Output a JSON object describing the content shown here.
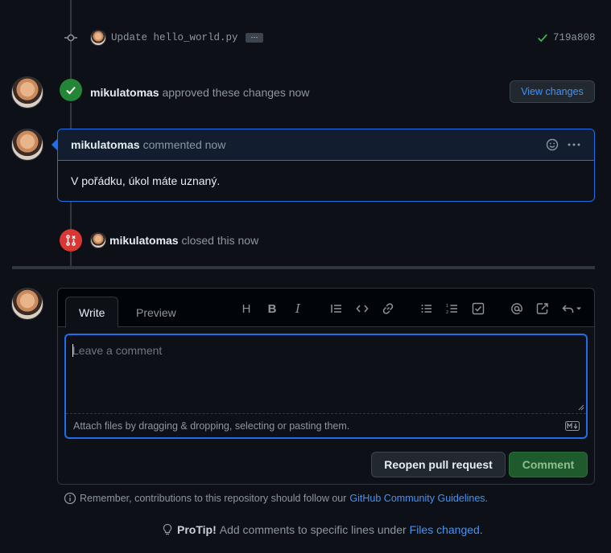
{
  "commit": {
    "message": "Update hello_world.py",
    "more": "···",
    "sha": "719a808"
  },
  "approval": {
    "user": "mikulatomas",
    "text": "approved these changes now",
    "view_changes": "View changes"
  },
  "comment": {
    "user": "mikulatomas",
    "meta": "commented now",
    "body": "V pořádku, úkol máte uznaný."
  },
  "closed_event": {
    "user": "mikulatomas",
    "text": "closed this now"
  },
  "editor": {
    "tab_write": "Write",
    "tab_preview": "Preview",
    "placeholder": "Leave a comment",
    "attach_hint": "Attach files by dragging & dropping, selecting or pasting them.",
    "reopen_button": "Reopen pull request",
    "comment_button": "Comment"
  },
  "guidelines": {
    "prefix": "Remember, contributions to this repository should follow our",
    "link": "GitHub Community Guidelines",
    "suffix": "."
  },
  "protip": {
    "label": "ProTip!",
    "text": "Add comments to specific lines under",
    "link": "Files changed",
    "suffix": "."
  },
  "colors": {
    "background": "#0d1117",
    "accent_blue": "#4493f8",
    "approved_green": "#238636",
    "closed_red": "#da3633",
    "comment_button": "#238636"
  }
}
